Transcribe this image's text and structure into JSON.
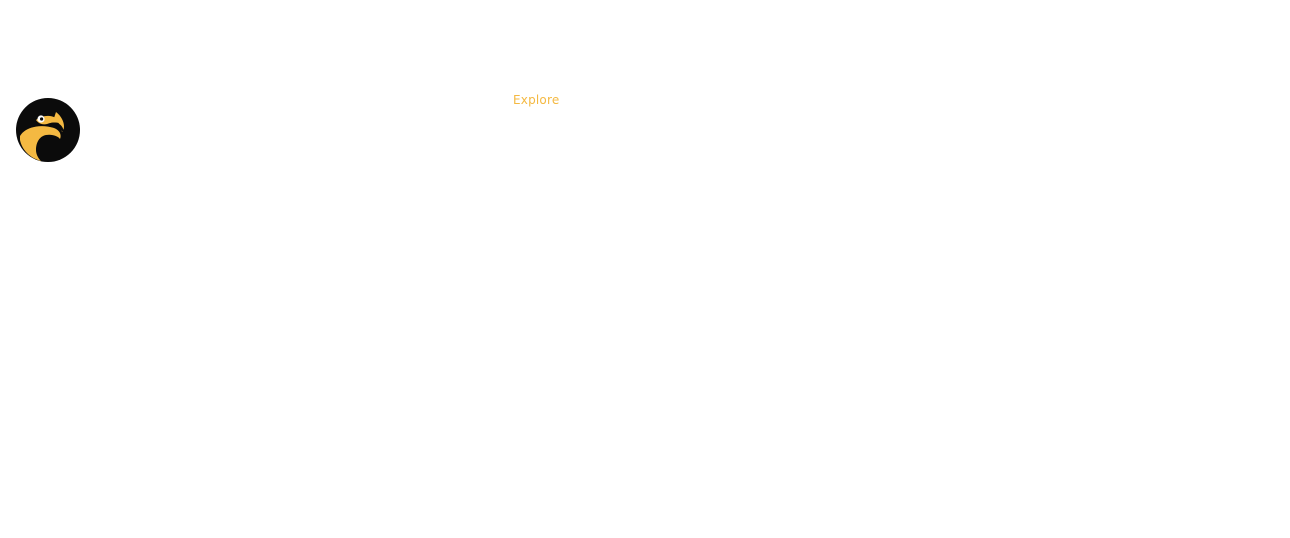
{
  "header": {
    "logo_icon": "eagle-logo-icon",
    "nav": {
      "explore_label": "Explore"
    }
  },
  "colors": {
    "accent": "#f4b942",
    "logo_bg": "#0b0b0b",
    "background": "#ffffff"
  }
}
